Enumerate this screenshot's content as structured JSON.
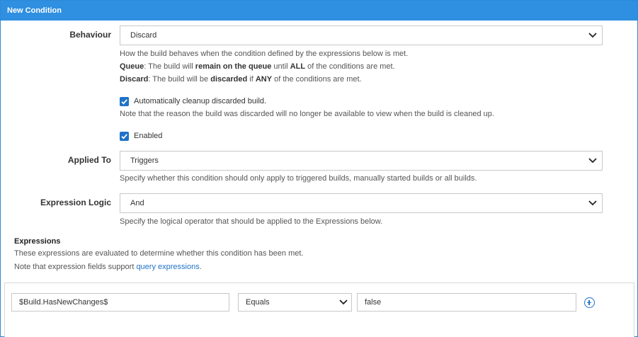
{
  "dialog": {
    "title": "New Condition"
  },
  "behaviour": {
    "label": "Behaviour",
    "value": "Discard",
    "help_line1": "How the build behaves when the condition defined by the expressions below is met.",
    "queue_term": "Queue",
    "queue_text_a": ": The build will ",
    "queue_strong": "remain on the queue",
    "queue_text_b": " until ",
    "queue_all": "ALL",
    "queue_text_c": " of the conditions are met.",
    "discard_term": "Discard",
    "discard_text_a": ": The build will be ",
    "discard_strong": "discarded",
    "discard_text_b": " if ",
    "discard_any": "ANY",
    "discard_text_c": " of the conditions are met."
  },
  "cleanup": {
    "label": "Automatically cleanup discarded build.",
    "checked": true,
    "help": "Note that the reason the build was discarded will no longer be available to view when the build is cleaned up."
  },
  "enabled": {
    "label": "Enabled",
    "checked": true
  },
  "applied_to": {
    "label": "Applied To",
    "value": "Triggers",
    "help": "Specify whether this condition should only apply to triggered builds, manually started builds or all builds."
  },
  "expression_logic": {
    "label": "Expression Logic",
    "value": "And",
    "help": "Specify the logical operator that should be applied to the Expressions below."
  },
  "expressions": {
    "title": "Expressions",
    "help_line1": "These expressions are evaluated to determine whether this condition has been met.",
    "help_line2_prefix": "Note that expression fields support ",
    "help_link": "query expressions",
    "help_line2_suffix": ".",
    "rows": [
      {
        "left": "$Build.HasNewChanges$",
        "operator": "Equals",
        "right": "false"
      }
    ]
  },
  "icons": {
    "select_arrow": "chevron-down-icon",
    "checkbox": "checkmark-icon",
    "add": "plus-circle-icon"
  },
  "colors": {
    "accent": "#2f8fe0",
    "checkbox": "#1f72c7",
    "link": "#1f72c7"
  }
}
